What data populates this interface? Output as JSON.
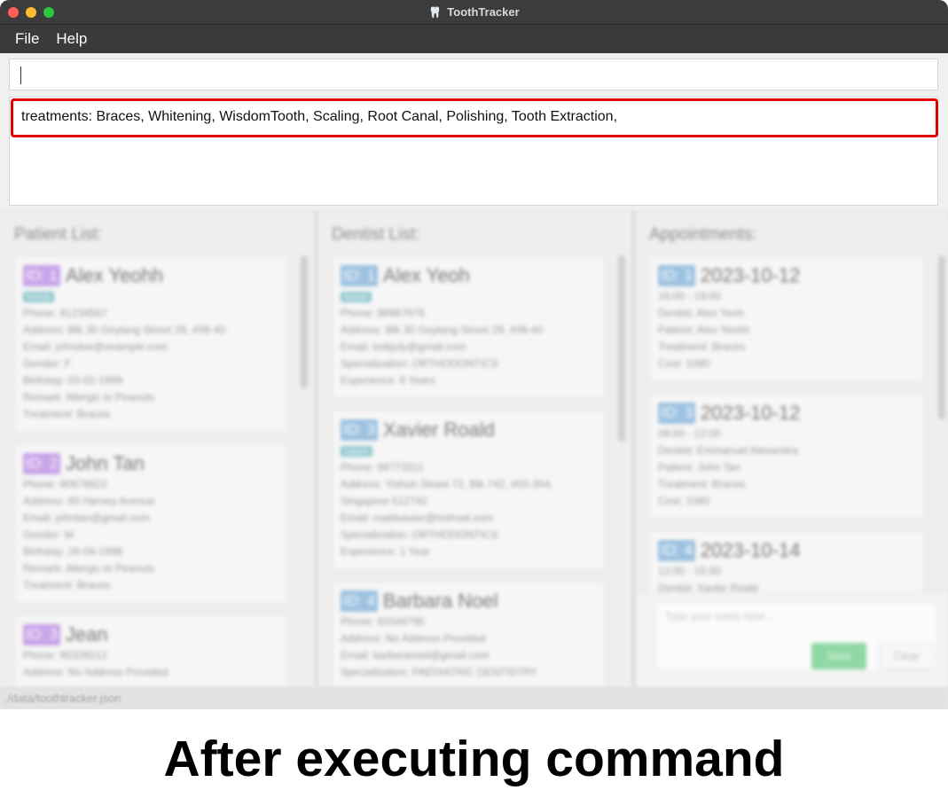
{
  "window": {
    "title": "ToothTracker"
  },
  "menu": [
    "File",
    "Help"
  ],
  "command": {
    "value": ""
  },
  "result": {
    "text": "treatments: Braces, Whitening, WisdomTooth, Scaling, Root Canal, Polishing, Tooth Extraction,"
  },
  "patients": {
    "header": "Patient List:",
    "items": [
      {
        "id": "ID: 1",
        "name": "Alex Yeohh",
        "tag": "friends",
        "lines": [
          "Phone: 91234567",
          "Address: Blk 30 Geylang Street 29, #06-40",
          "Email: johndoe@example.com",
          "Gender: F",
          "Birthday: 03-02-1999",
          "Remark: Allergic to Peanuts",
          "Treatment: Braces"
        ]
      },
      {
        "id": "ID: 2",
        "name": "John Tan",
        "tag": "",
        "lines": [
          "Phone: 90676622",
          "Address: 60 Harvey Avenue",
          "Email: johntan@gmail.com",
          "Gender: M",
          "Birthday: 26-06-1998",
          "Remark: Allergic to Peanuts",
          "Treatment: Braces"
        ]
      },
      {
        "id": "ID: 3",
        "name": "Jean",
        "tag": "",
        "lines": [
          "Phone: 95339212",
          "Address: No Address Provided"
        ]
      }
    ]
  },
  "dentists": {
    "header": "Dentist List:",
    "items": [
      {
        "id": "ID: 1",
        "name": "Alex Yeoh",
        "tag": "friends",
        "lines": [
          "Phone: 98987676",
          "Address: Blk 30 Geylang Street 29, #06-40",
          "Email: bobjuly@gmail.com",
          "Specialization: ORTHODONTICS",
          "Experience: 6 Years"
        ]
      },
      {
        "id": "ID: 3",
        "name": "Xavier Roald",
        "tag": "trainee",
        "lines": [
          "Phone: 99773311",
          "Address: Yishun Street 72, Blk 742, #03-354,",
          "Singapore 512742",
          "Email: roaldxavier@hotmail.com",
          "Specialization: ORTHODONTICS",
          "Experience: 1 Year"
        ]
      },
      {
        "id": "ID: 4",
        "name": "Barbara Noel",
        "tag": "",
        "lines": [
          "Phone: 93349795",
          "Address: No Address Provided",
          "Email: barbaranoel@gmail.com",
          "Specialization: PAEDIATRIC DENTISTRY"
        ]
      }
    ]
  },
  "appointments": {
    "header": "Appointments:",
    "items": [
      {
        "id": "ID: 1",
        "name": "2023-10-12",
        "tag": "",
        "lines": [
          "16:00 - 19:00",
          "Dentist: Alex Yeoh",
          "Patient: Alex Yeohh",
          "Treatment: Braces",
          "Cost: 1080"
        ]
      },
      {
        "id": "ID: 3",
        "name": "2023-10-12",
        "tag": "",
        "lines": [
          "09:00 - 12:00",
          "Dentist: Emmanuel Alexandra",
          "Patient: John Tan",
          "Treatment: Braces",
          "Cost: 1080"
        ]
      },
      {
        "id": "ID: 4",
        "name": "2023-10-14",
        "tag": "",
        "lines": [
          "12:00 - 15:00",
          "Dentist: Xavier Roald"
        ]
      }
    ]
  },
  "notes": {
    "placeholder": "Type your notes here...",
    "save_label": "Save",
    "clear_label": "Clear"
  },
  "status": {
    "path": "./data/toothtracker.json"
  },
  "caption": "After executing command"
}
